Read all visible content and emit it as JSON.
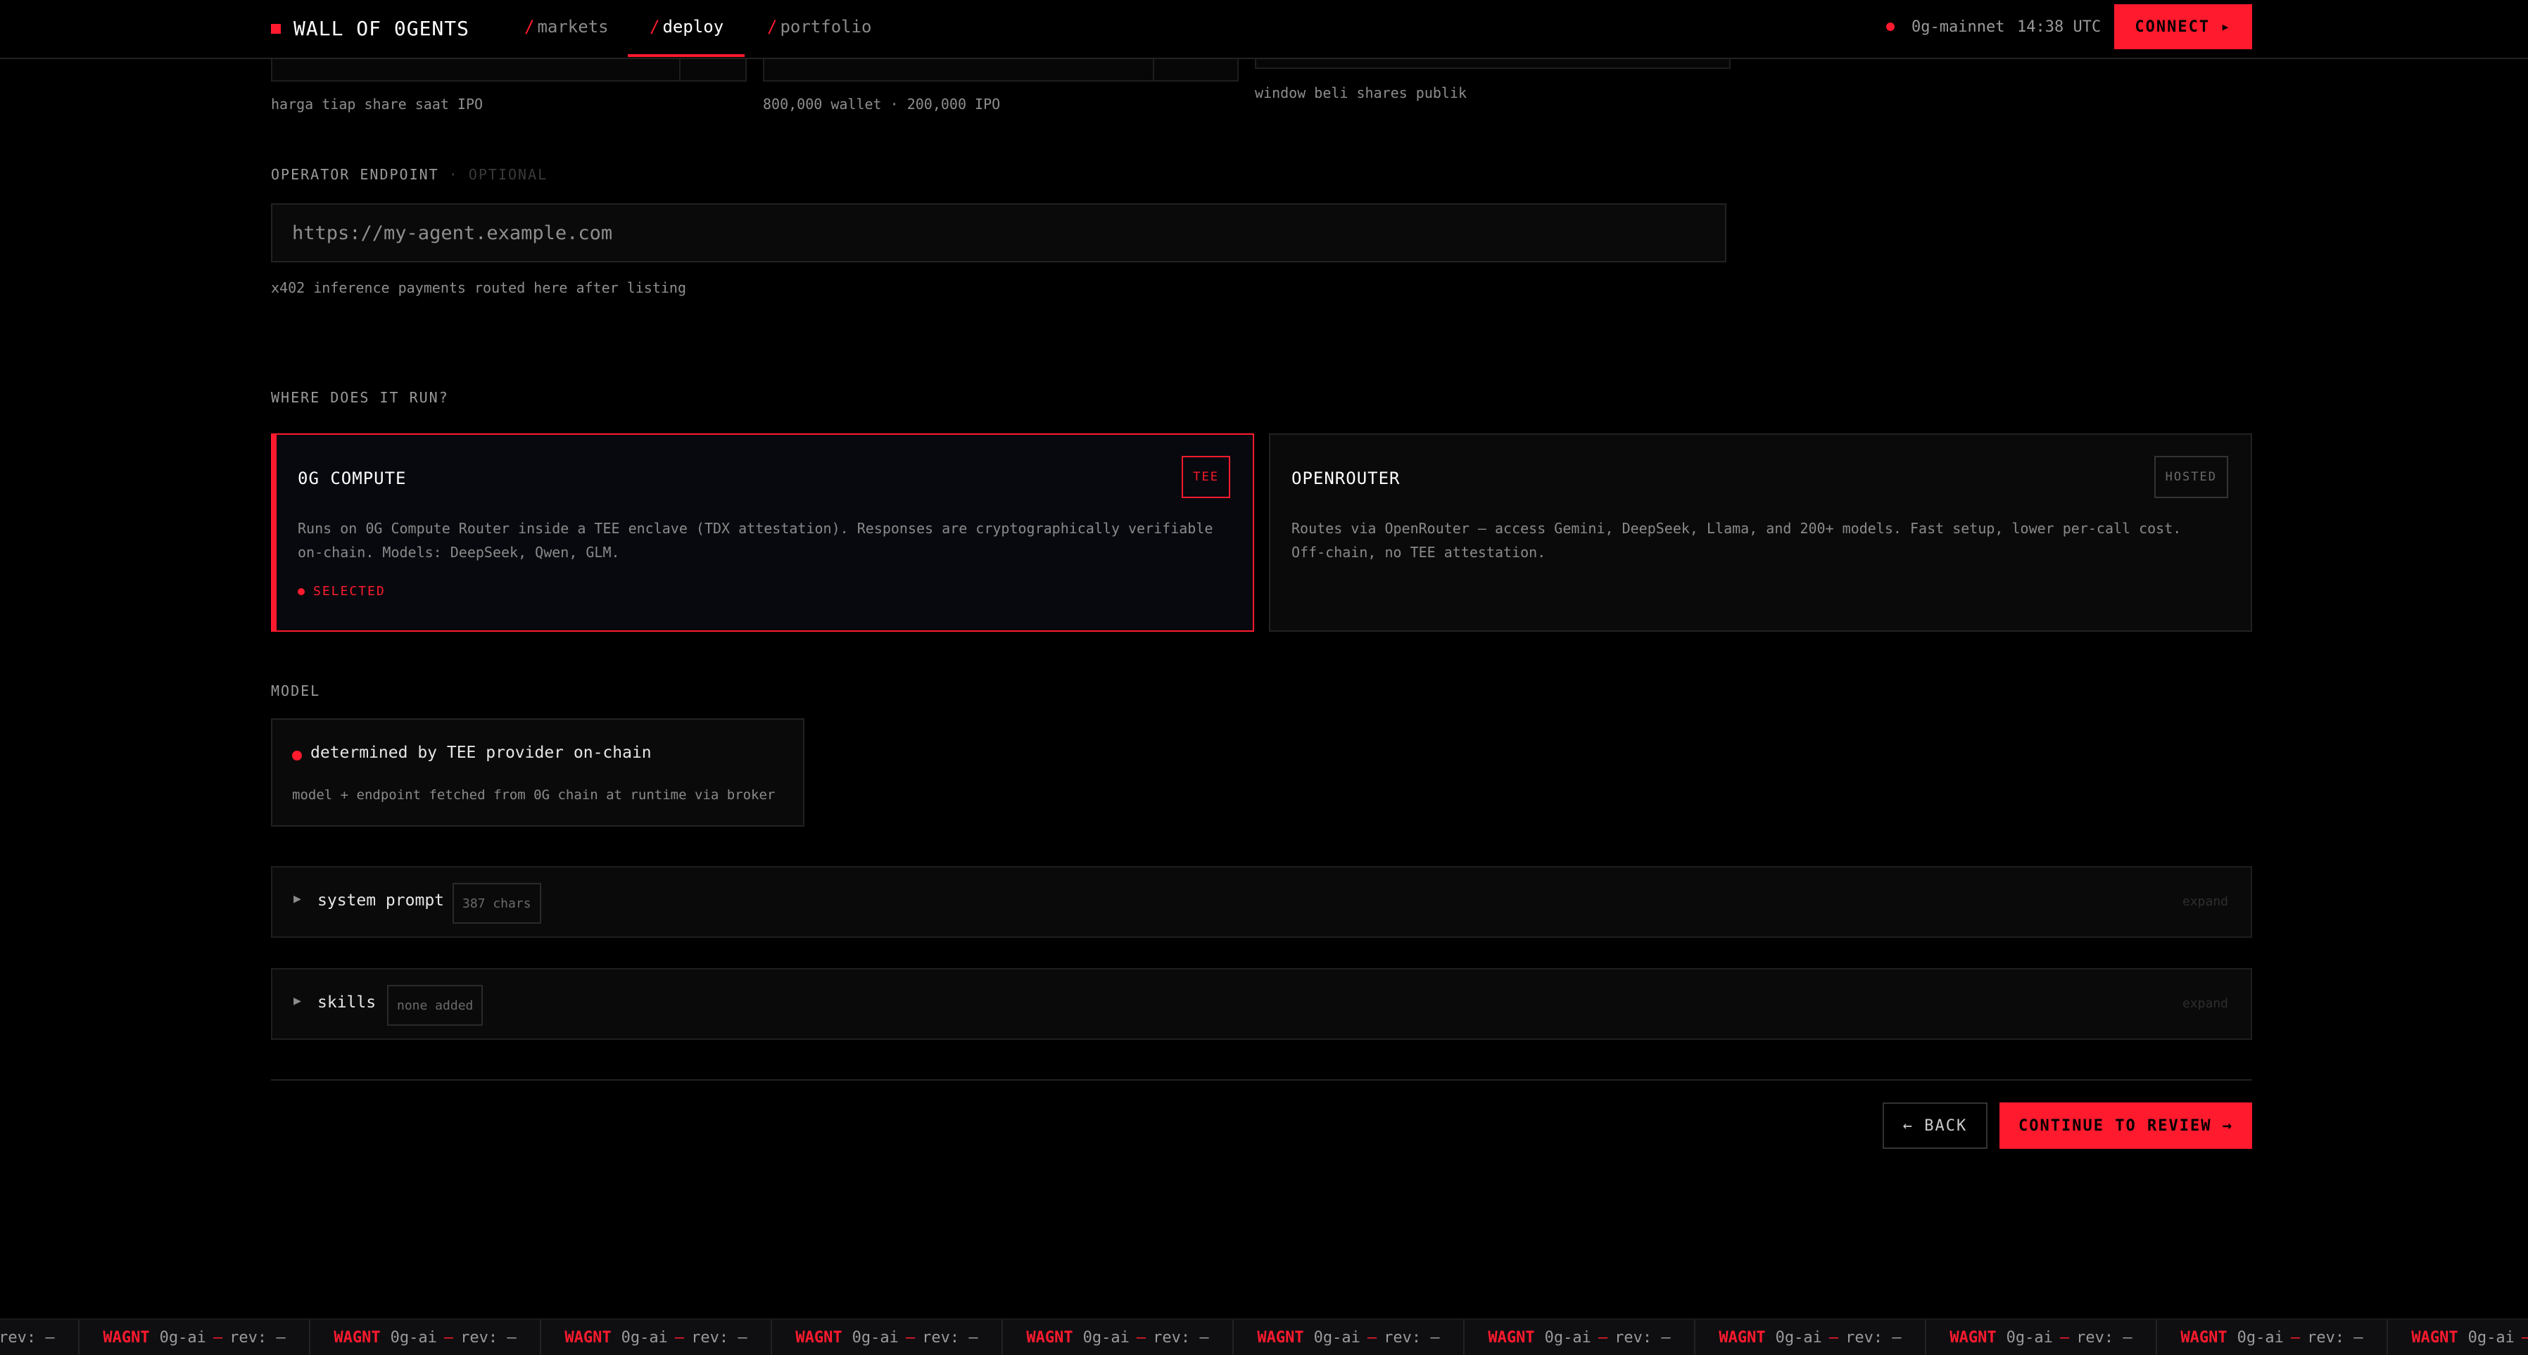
{
  "nav": {
    "brand": "WALL OF 0GENTS",
    "links": [
      {
        "slash": "/",
        "label": "markets"
      },
      {
        "slash": "/",
        "label": "deploy"
      },
      {
        "slash": "/",
        "label": "portfolio"
      }
    ],
    "active": "deploy",
    "network": "0g-mainnet",
    "time": "14:38 UTC",
    "connect_label": "CONNECT ▸"
  },
  "top_fields": {
    "hints": [
      "harga tiap share saat IPO",
      "800,000 wallet · 200,000 IPO",
      "window beli shares publik"
    ]
  },
  "endpoint": {
    "label": "OPERATOR ENDPOINT",
    "optional": "· OPTIONAL",
    "placeholder": "https://my-agent.example.com",
    "hint": "x402 inference payments routed here after listing"
  },
  "runtime": {
    "label": "WHERE DOES IT RUN?",
    "options": [
      {
        "title": "0G COMPUTE",
        "badge": "TEE",
        "description": "Runs on 0G Compute Router inside a TEE enclave (TDX attestation). Responses are cryptographically verifiable on-chain. Models: DeepSeek, Qwen, GLM.",
        "status": "SELECTED",
        "selected": true
      },
      {
        "title": "OPENROUTER",
        "badge": "HOSTED",
        "description": "Routes via OpenRouter — access Gemini, DeepSeek, Llama, and 200+ models. Fast setup, lower per-call cost. Off-chain, no TEE attestation.",
        "selected": false
      }
    ]
  },
  "model": {
    "label": "MODEL",
    "main": "determined by TEE provider on-chain",
    "sub": "model + endpoint fetched from 0G chain at runtime via broker"
  },
  "sections": [
    {
      "title": "system prompt",
      "chip": "387 chars",
      "action": "expand"
    },
    {
      "title": "skills",
      "chip": "none added",
      "action": "expand"
    }
  ],
  "actions": {
    "back": "← BACK",
    "continue": "CONTINUE TO REVIEW →"
  },
  "ticker": {
    "symbol": "WAGNT",
    "chain": "0g-ai",
    "rev": "rev: —"
  },
  "colors": {
    "accent": "#ff1a2e",
    "background": "#000000"
  }
}
